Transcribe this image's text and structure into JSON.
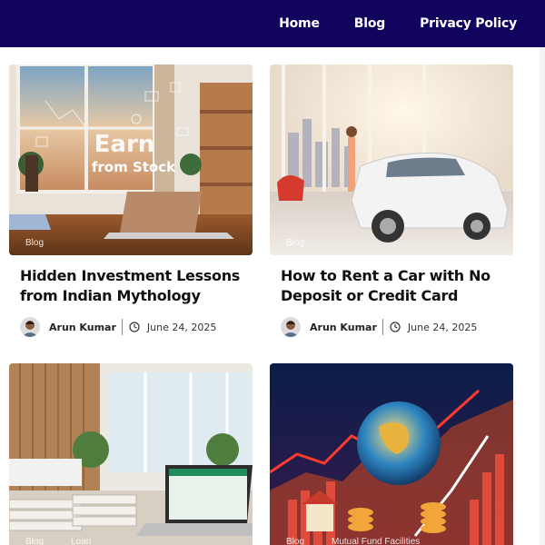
{
  "nav": {
    "items": [
      "Home",
      "Blog",
      "Privacy Policy"
    ]
  },
  "posts": [
    {
      "title": "Hidden Investment Lessons from Indian Mythology",
      "tags": [
        "Blog"
      ],
      "image_text": [
        "Earn",
        "from Stock"
      ],
      "author": "Arun Kumar",
      "date": "June 24, 2025",
      "icons": [
        "avatar-image",
        "clock-icon"
      ]
    },
    {
      "title": "How to Rent a Car with No Deposit or Credit Card",
      "tags": [
        "Blog"
      ],
      "author": "Arun Kumar",
      "date": "June 24, 2025",
      "icons": [
        "avatar-image",
        "clock-icon"
      ]
    },
    {
      "tags": [
        "Blog",
        "Loan"
      ]
    },
    {
      "tags": [
        "Blog",
        "Mutual Fund Facilities"
      ]
    }
  ],
  "colors": {
    "header_bg": "#13015e",
    "text": "#111111"
  }
}
